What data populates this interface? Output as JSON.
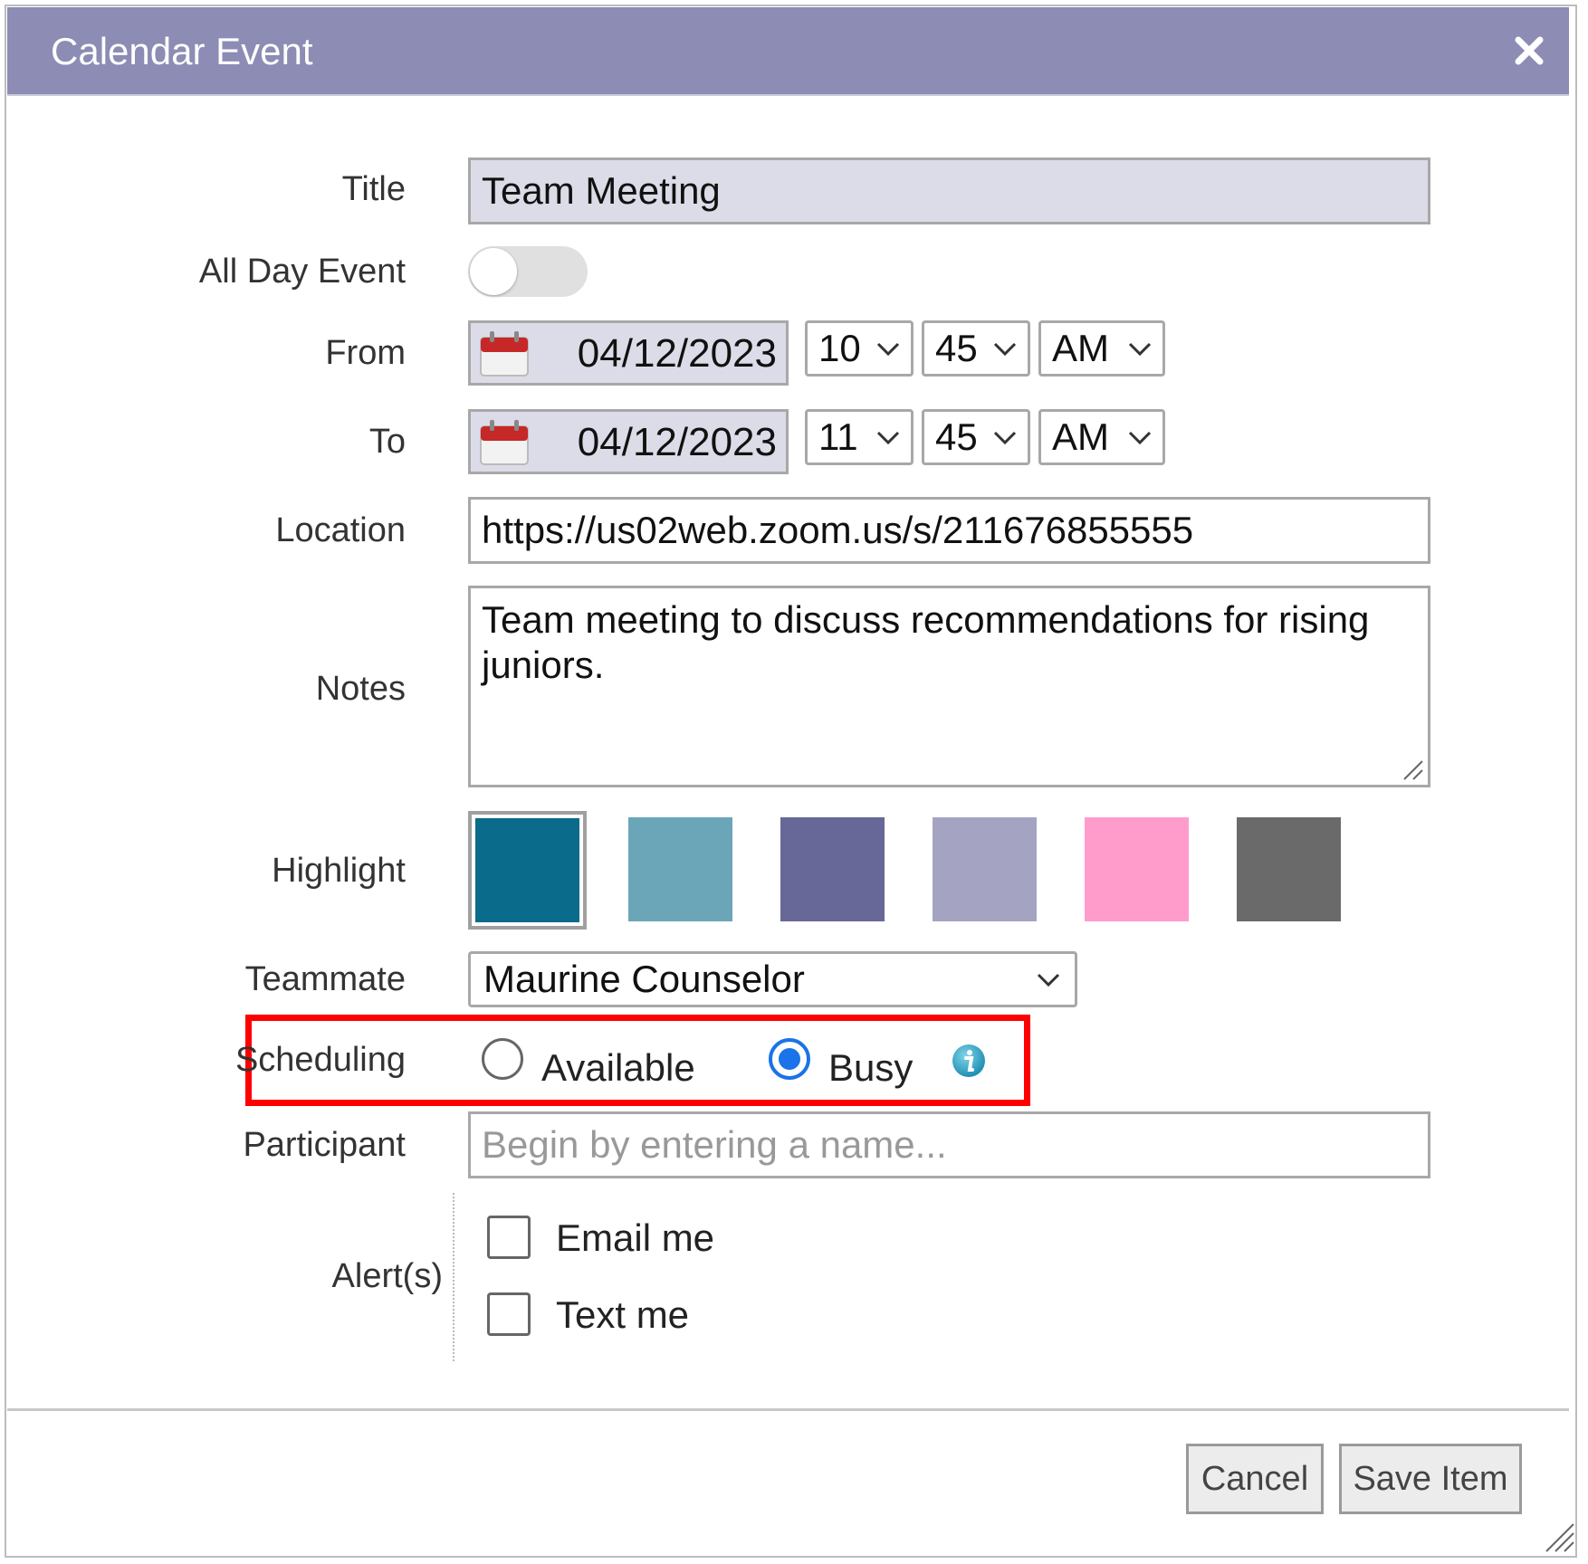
{
  "dialog": {
    "title": "Calendar Event"
  },
  "form": {
    "title_label": "Title",
    "title_value": "Team Meeting",
    "all_day_label": "All Day Event",
    "all_day_on": false,
    "from_label": "From",
    "from_date": "04/12/2023",
    "from_hour": "10",
    "from_minute": "45",
    "from_ampm": "AM",
    "to_label": "To",
    "to_date": "04/12/2023",
    "to_hour": "11",
    "to_minute": "45",
    "to_ampm": "AM",
    "location_label": "Location",
    "location_value": "https://us02web.zoom.us/s/211676855555",
    "notes_label": "Notes",
    "notes_value": "Team meeting to discuss recommendations for rising juniors.",
    "highlight_label": "Highlight",
    "highlight_colors": [
      "#0b6b8a",
      "#6ba6b8",
      "#686898",
      "#a4a4c2",
      "#ff9ccc",
      "#6a6a6a"
    ],
    "teammate_label": "Teammate",
    "teammate_value": "Maurine Counselor",
    "scheduling_label": "Scheduling",
    "scheduling_available": "Available",
    "scheduling_busy": "Busy",
    "participant_label": "Participant",
    "participant_placeholder": "Begin by entering a name...",
    "alerts_label": "Alert(s)",
    "alert_email": "Email me",
    "alert_text": "Text me"
  },
  "footer": {
    "cancel_label": "Cancel",
    "save_label": "Save Item"
  },
  "colors": {
    "titlebar": "#8c8cb4",
    "highlight_box": "#ff0000",
    "radio_checked": "#1a73e8"
  }
}
